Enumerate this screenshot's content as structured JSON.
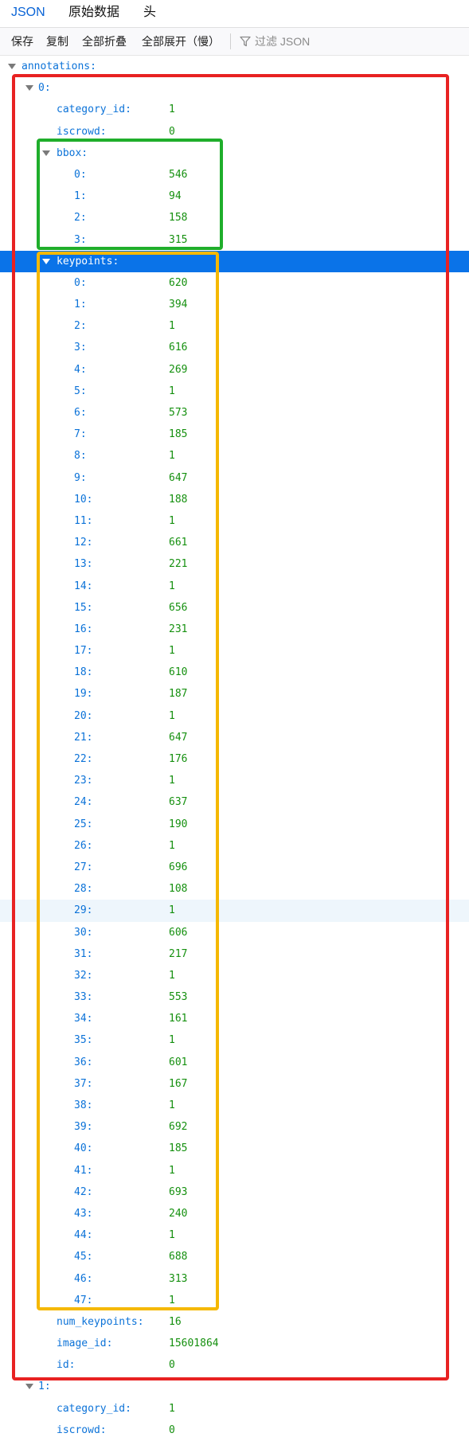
{
  "tabs": [
    {
      "label": "JSON",
      "active": true
    },
    {
      "label": "原始数据",
      "active": false
    },
    {
      "label": "头",
      "active": false
    }
  ],
  "toolbar": {
    "save": "保存",
    "copy": "复制",
    "collapse_all": "全部折叠",
    "expand_all": "全部展开（慢）",
    "filter_placeholder": "过滤 JSON",
    "filter_icon": "funnel-icon"
  },
  "tree": {
    "root_key": "annotations:",
    "item0": {
      "key": "0:",
      "category_id": {
        "key": "category_id:",
        "value": "1"
      },
      "iscrowd": {
        "key": "iscrowd:",
        "value": "0"
      },
      "bbox": {
        "key": "bbox:",
        "items": [
          {
            "key": "0:",
            "value": "546"
          },
          {
            "key": "1:",
            "value": "94"
          },
          {
            "key": "2:",
            "value": "158"
          },
          {
            "key": "3:",
            "value": "315"
          }
        ]
      },
      "keypoints": {
        "key": "keypoints:",
        "selected": true,
        "items": [
          {
            "key": "0:",
            "value": "620"
          },
          {
            "key": "1:",
            "value": "394"
          },
          {
            "key": "2:",
            "value": "1"
          },
          {
            "key": "3:",
            "value": "616"
          },
          {
            "key": "4:",
            "value": "269"
          },
          {
            "key": "5:",
            "value": "1"
          },
          {
            "key": "6:",
            "value": "573"
          },
          {
            "key": "7:",
            "value": "185"
          },
          {
            "key": "8:",
            "value": "1"
          },
          {
            "key": "9:",
            "value": "647"
          },
          {
            "key": "10:",
            "value": "188"
          },
          {
            "key": "11:",
            "value": "1"
          },
          {
            "key": "12:",
            "value": "661"
          },
          {
            "key": "13:",
            "value": "221"
          },
          {
            "key": "14:",
            "value": "1"
          },
          {
            "key": "15:",
            "value": "656"
          },
          {
            "key": "16:",
            "value": "231"
          },
          {
            "key": "17:",
            "value": "1"
          },
          {
            "key": "18:",
            "value": "610"
          },
          {
            "key": "19:",
            "value": "187"
          },
          {
            "key": "20:",
            "value": "1"
          },
          {
            "key": "21:",
            "value": "647"
          },
          {
            "key": "22:",
            "value": "176"
          },
          {
            "key": "23:",
            "value": "1"
          },
          {
            "key": "24:",
            "value": "637"
          },
          {
            "key": "25:",
            "value": "190"
          },
          {
            "key": "26:",
            "value": "1"
          },
          {
            "key": "27:",
            "value": "696"
          },
          {
            "key": "28:",
            "value": "108"
          },
          {
            "key": "29:",
            "value": "1"
          },
          {
            "key": "30:",
            "value": "606"
          },
          {
            "key": "31:",
            "value": "217"
          },
          {
            "key": "32:",
            "value": "1"
          },
          {
            "key": "33:",
            "value": "553"
          },
          {
            "key": "34:",
            "value": "161"
          },
          {
            "key": "35:",
            "value": "1"
          },
          {
            "key": "36:",
            "value": "601"
          },
          {
            "key": "37:",
            "value": "167"
          },
          {
            "key": "38:",
            "value": "1"
          },
          {
            "key": "39:",
            "value": "692"
          },
          {
            "key": "40:",
            "value": "185"
          },
          {
            "key": "41:",
            "value": "1"
          },
          {
            "key": "42:",
            "value": "693"
          },
          {
            "key": "43:",
            "value": "240"
          },
          {
            "key": "44:",
            "value": "1"
          },
          {
            "key": "45:",
            "value": "688"
          },
          {
            "key": "46:",
            "value": "313"
          },
          {
            "key": "47:",
            "value": "1"
          }
        ]
      },
      "num_keypoints": {
        "key": "num_keypoints:",
        "value": "16"
      },
      "image_id": {
        "key": "image_id:",
        "value": "15601864"
      },
      "id": {
        "key": "id:",
        "value": "0"
      }
    },
    "item1": {
      "key": "1:",
      "category_id": {
        "key": "category_id:",
        "value": "1"
      },
      "iscrowd": {
        "key": "iscrowd:",
        "value": "0"
      }
    }
  },
  "highlight_colors": {
    "outer": "#e82222",
    "bbox": "#1fae2b",
    "keypoints": "#f5b800",
    "selection": "#0a73e8"
  }
}
